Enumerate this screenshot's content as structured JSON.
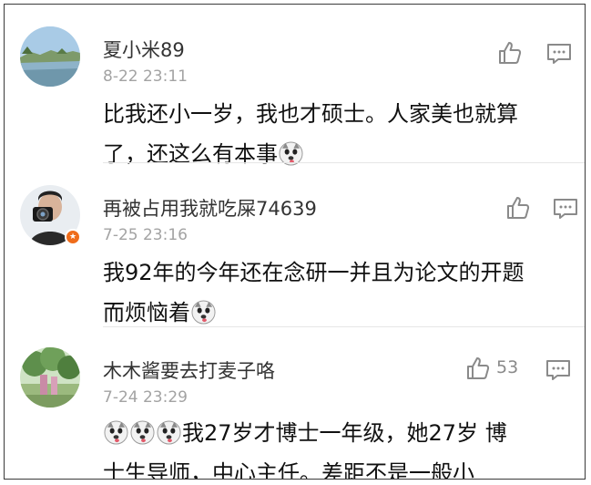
{
  "comments": [
    {
      "username": "夏小米89",
      "timestamp": "8-22 23:11",
      "text_lines": [
        "比我还小一岁，我也才硕士。人家美也就算",
        "了，还这么有本事"
      ],
      "like_count": "",
      "avatar": "lake-landscape",
      "verified_badge": false,
      "emoji_icon": "doge-emoji"
    },
    {
      "username": "再被占用我就吃屎74639",
      "timestamp": "7-25 23:16",
      "text_lines": [
        "我92年的今年还在念研一并且为论文的开题",
        "而烦恼着"
      ],
      "like_count": "",
      "avatar": "man-with-camera",
      "verified_badge": true,
      "emoji_icon": "doge-emoji"
    },
    {
      "username": "木木酱要去打麦子咯",
      "timestamp": "7-24 23:29",
      "text_lines": [
        "我27岁才博士一年级，她27岁 博",
        "士生导师，中心主任。差距不是一般小"
      ],
      "like_count": "53",
      "avatar": "garden-trees",
      "verified_badge": false,
      "emoji_icon": "doge-emoji"
    }
  ],
  "icons": {
    "like": "thumbs-up-icon",
    "reply": "comment-bubble-icon",
    "badge": "verified-badge-icon"
  },
  "colors": {
    "username": "#333333",
    "timestamp": "#a3a3a3",
    "body": "#111111",
    "icon": "#8a8a8a",
    "badge": "#ef6c1a",
    "border": "#3a3a3a"
  }
}
